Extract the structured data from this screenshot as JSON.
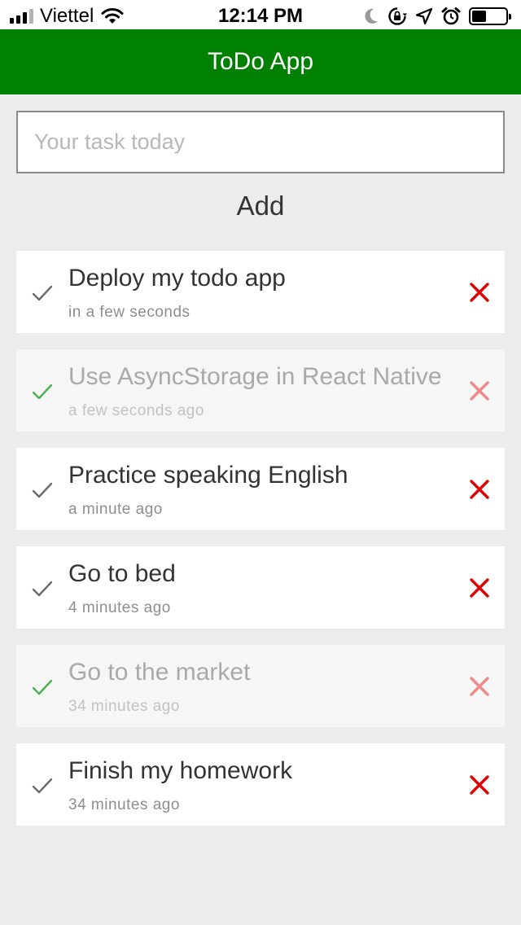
{
  "status_bar": {
    "carrier": "Viettel",
    "time": "12:14 PM",
    "battery_level": 0.42
  },
  "header": {
    "title": "ToDo App",
    "color": "#008000"
  },
  "input": {
    "placeholder": "Your task today",
    "value": ""
  },
  "add_button": {
    "label": "Add"
  },
  "colors": {
    "check_active": "#6b6b6b",
    "check_done": "#4caf50",
    "delete_active": "#e00000",
    "delete_done": "#f08a8a"
  },
  "tasks": [
    {
      "title": "Deploy my todo app",
      "time": "in a few seconds",
      "done": false
    },
    {
      "title": "Use AsyncStorage in React Native",
      "time": "a few seconds ago",
      "done": true
    },
    {
      "title": "Practice speaking English",
      "time": "a minute ago",
      "done": false
    },
    {
      "title": "Go to bed",
      "time": "4 minutes ago",
      "done": false
    },
    {
      "title": "Go to the market",
      "time": "34 minutes ago",
      "done": true
    },
    {
      "title": "Finish my homework",
      "time": "34 minutes ago",
      "done": false
    }
  ]
}
